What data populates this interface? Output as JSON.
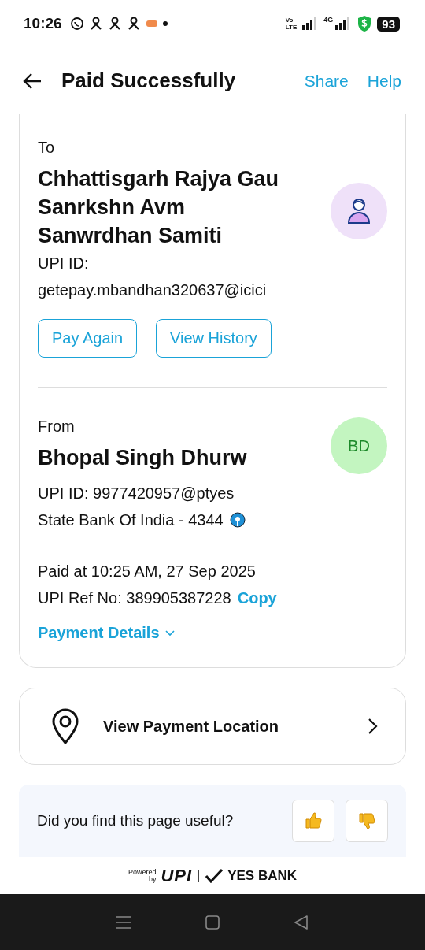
{
  "status_bar": {
    "time": "10:26",
    "network_1": "Vo",
    "network_2": "LTE",
    "network_3": "4G",
    "battery": "93"
  },
  "header": {
    "title": "Paid Successfully",
    "actions": [
      "Share",
      "Help"
    ]
  },
  "to": {
    "label": "To",
    "name": "Chhattisgarh Rajya Gau Sanrkshn Avm Sanwrdhan Samiti",
    "upi_label": "UPI ID:",
    "upi_id": "getepay.mbandhan320637@icici",
    "buttons": [
      "Pay Again",
      "View History"
    ]
  },
  "from": {
    "label": "From",
    "name": "Bhopal Singh Dhurw",
    "initials": "BD",
    "upi": "UPI ID: 9977420957@ptyes",
    "bank": "State Bank Of India - 4344",
    "paid_at": "Paid at 10:25 AM, 27 Sep 2025",
    "ref": "UPI Ref No: 389905387228",
    "copy": "Copy",
    "details": "Payment Details"
  },
  "location": {
    "label": "View Payment Location"
  },
  "feedback": {
    "question": "Did you find this page useful?"
  },
  "footer": {
    "powered": "Powered",
    "by": "by",
    "upi": "UPI",
    "bank": "YES BANK"
  }
}
